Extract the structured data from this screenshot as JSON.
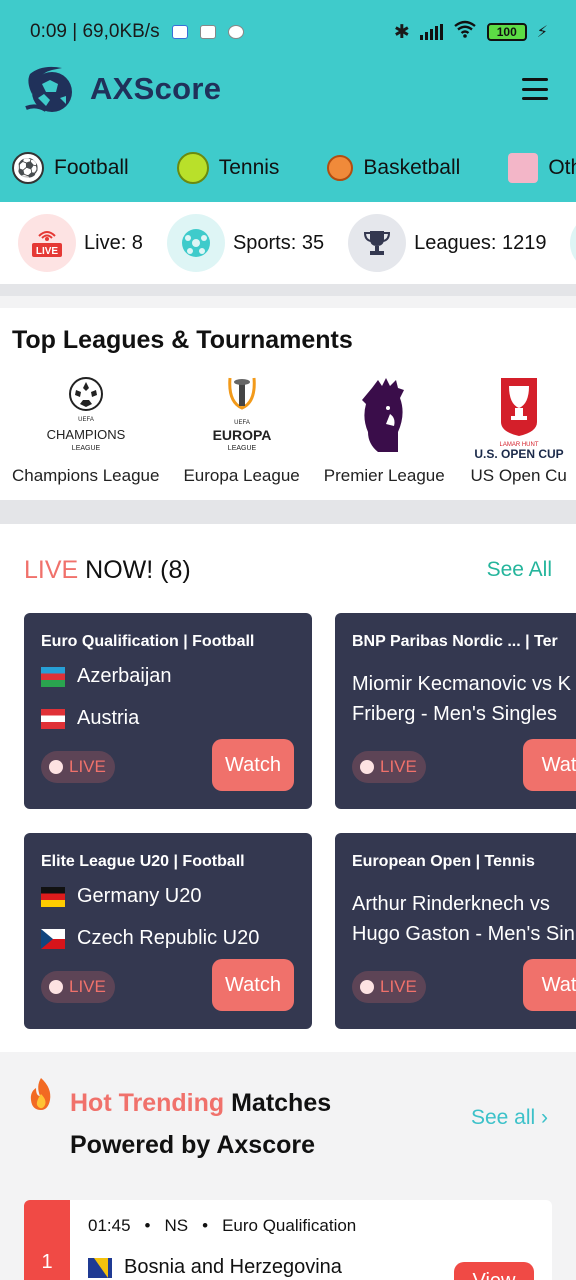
{
  "status_bar": {
    "time_speed": "0:09 | 69,0KB/s",
    "battery": "100"
  },
  "header": {
    "brand": "AXScore",
    "menu_icon": "hamburger-menu-icon"
  },
  "sport_tabs": [
    {
      "label": "Football",
      "icon": "soccer-ball-icon"
    },
    {
      "label": "Tennis",
      "icon": "tennis-ball-icon"
    },
    {
      "label": "Basketball",
      "icon": "basketball-icon"
    },
    {
      "label": "Oth",
      "icon": "other-sports-icon"
    }
  ],
  "stats": [
    {
      "label": "Live: 8",
      "icon": "live-broadcast-icon"
    },
    {
      "label": "Sports: 35",
      "icon": "soccer-ball-icon"
    },
    {
      "label": "Leagues: 1219",
      "icon": "trophy-icon"
    }
  ],
  "top_leagues": {
    "title": "Top Leagues & Tournaments",
    "items": [
      {
        "name": "Champions League",
        "logo_text": "CHAMPIONS",
        "logo_sub": "LEAGUE",
        "logo_top": "UEFA"
      },
      {
        "name": "Europa League",
        "logo_text": "EUROPA",
        "logo_sub": "LEAGUE",
        "logo_top": "UEFA"
      },
      {
        "name": "Premier League"
      },
      {
        "name": "US Open Cu",
        "logo_text": "U.S. OPEN CUP",
        "logo_top": "LAMAR HUNT"
      }
    ]
  },
  "live_now": {
    "title_highlight": "LIVE",
    "title_rest": " NOW! (8)",
    "see_all": "See All",
    "cards": [
      {
        "competition": "Euro Qualification | Football",
        "team1": "Azerbaijan",
        "team2": "Austria",
        "live_label": "LIVE",
        "watch_label": "Watch"
      },
      {
        "competition": "BNP Paribas Nordic ...    | Ter",
        "line1": "Miomir Kecmanovic vs K",
        "line2": "Friberg - Men's Singles",
        "live_label": "LIVE",
        "watch_label": "Watc"
      },
      {
        "competition": "Elite League U20 | Football",
        "team1": "Germany U20",
        "team2": "Czech Republic U20",
        "live_label": "LIVE",
        "watch_label": "Watch"
      },
      {
        "competition": "European Open | Tennis",
        "line1": "Arthur Rinderknech vs",
        "line2": "Hugo Gaston - Men's Sin",
        "live_label": "LIVE",
        "watch_label": "Watc"
      }
    ]
  },
  "trending": {
    "title_highlight": "Hot Trending",
    "title_rest": " Matches",
    "title_line2": "Powered by Axscore",
    "see_all": "See all",
    "first": {
      "rank": "1",
      "time": "01:45",
      "status": "NS",
      "competition": "Euro Qualification",
      "team": "Bosnia and Herzegovina",
      "view_label": "View"
    }
  },
  "colors": {
    "header_bg": "#3fcbcb",
    "accent_red": "#f0716b",
    "card_bg": "#343850",
    "link_green": "#25b59c"
  }
}
